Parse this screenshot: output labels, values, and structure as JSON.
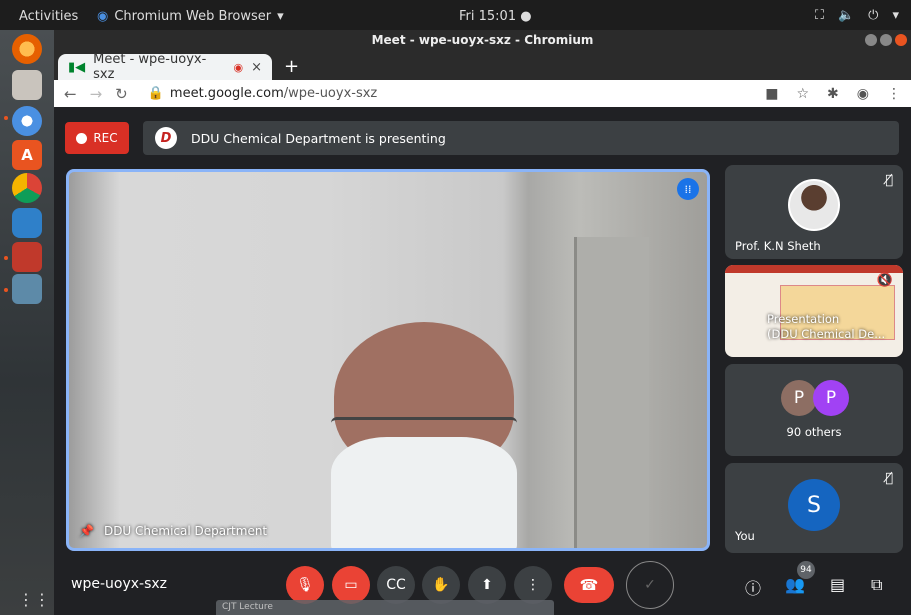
{
  "topbar": {
    "activities": "Activities",
    "app_menu": "Chromium Web Browser",
    "app_menu_arrow": "▾",
    "clock": "Fri 15:01",
    "clock_dot": "●"
  },
  "window": {
    "title": "Meet - wpe-uoyx-sxz - Chromium"
  },
  "tab": {
    "title": "Meet - wpe-uoyx-sxz",
    "close": "×",
    "new_tab": "+"
  },
  "omnibox": {
    "url_host": "meet.google.com",
    "url_path": "/wpe-uoyx-sxz"
  },
  "meet": {
    "rec_label": "REC",
    "presenting_banner": "DDU Chemical Department is presenting",
    "presenter_logo_letter": "D",
    "main_tile_name": "DDU Chemical Department",
    "tiles": {
      "sheth": "Prof. K.N Sheth",
      "presentation_line1": "Presentation",
      "presentation_line2": "(DDU Chemical De...",
      "others_avatar_1": "P",
      "others_avatar_2": "P",
      "others_label": "90 others",
      "you_avatar": "S",
      "you_label": "You"
    },
    "meeting_code": "wpe-uoyx-sxz",
    "participants_count": "94",
    "shelf_text": "CJT Lecture"
  },
  "colors": {
    "rec_red": "#d93025",
    "speaking_blue": "#1a73e8",
    "highlight_border": "#8ab4f8",
    "avatar_brown": "#8d6e63",
    "avatar_purple": "#a142f4",
    "avatar_blue": "#1565c0"
  }
}
